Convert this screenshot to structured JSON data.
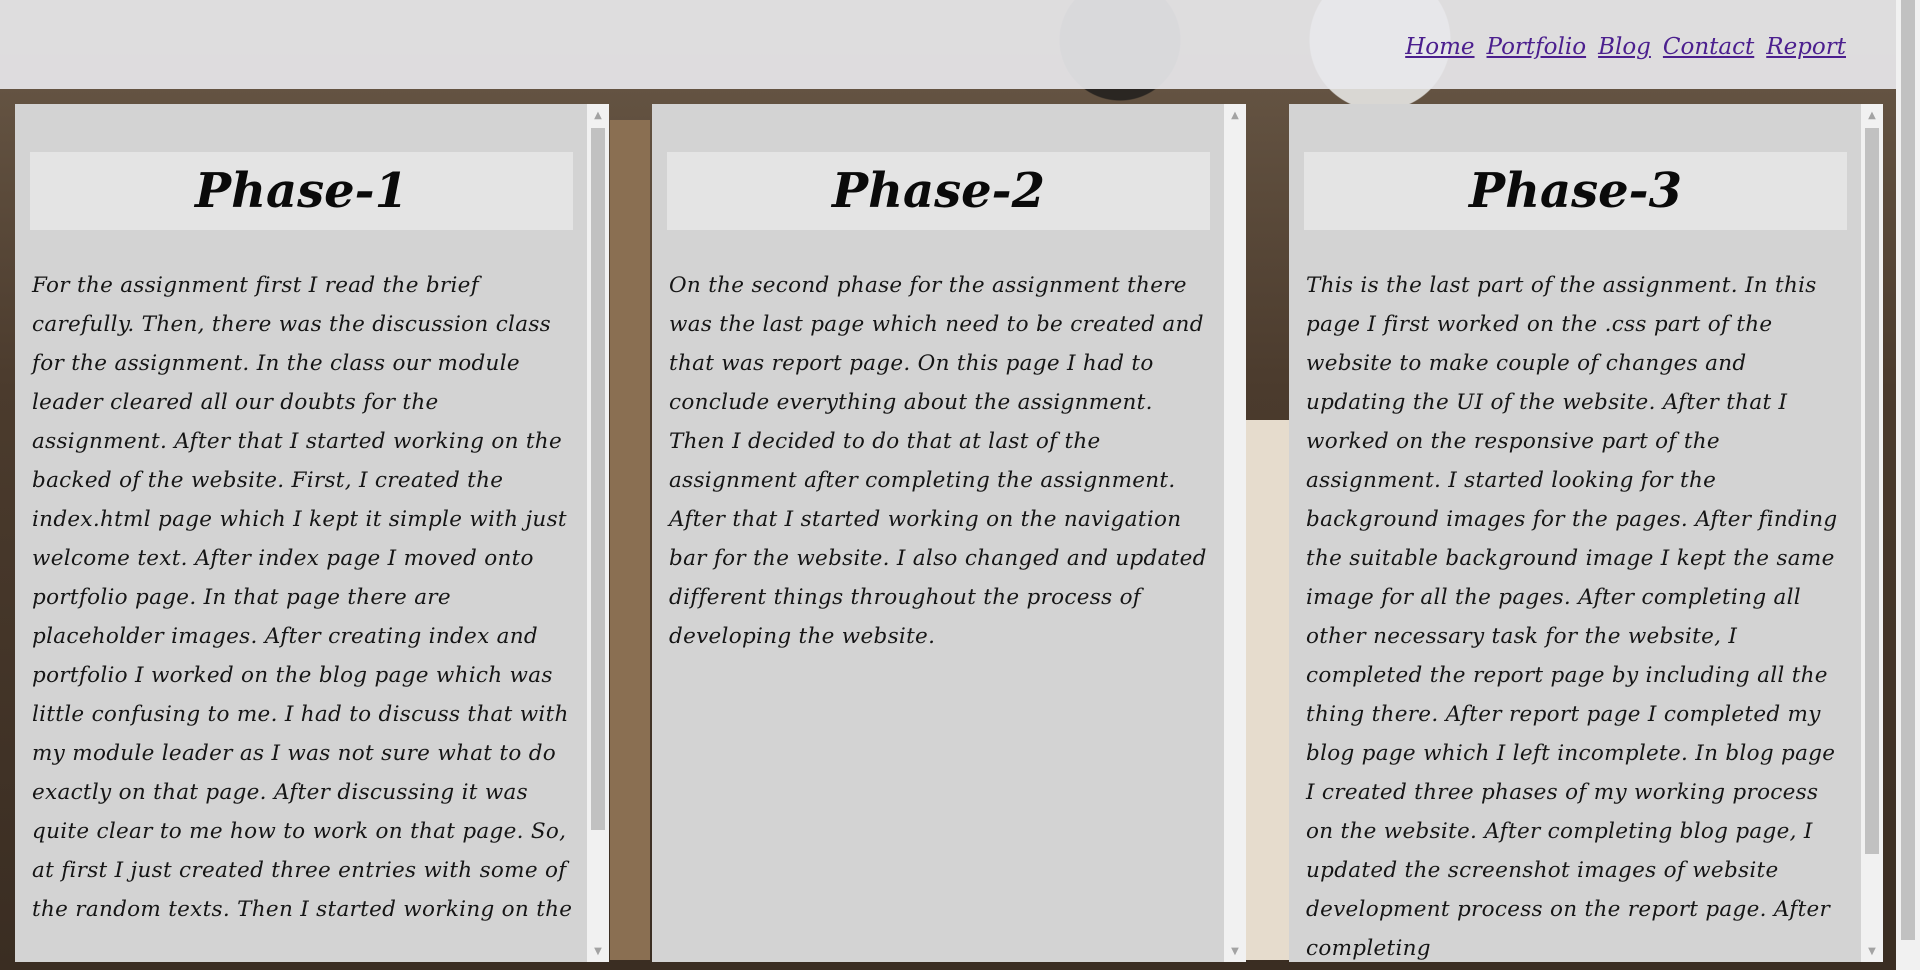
{
  "nav": {
    "items": [
      "Home",
      "Portfolio",
      "Blog",
      "Contact",
      "Report"
    ]
  },
  "phases": [
    {
      "title": "Phase-1",
      "text": "For the assignment first I read the brief carefully. Then, there was the discussion class for the assignment. In the class our module leader cleared all our doubts for the assignment. After that I started working on the backed of the website. First, I created the index.html page which I kept it simple with just welcome text. After index page I moved onto portfolio page. In that page there are placeholder images. After creating index and portfolio I worked on the blog page which was little confusing to me. I had to discuss that with my module leader as I was not sure what to do exactly on that page. After discussing it was quite clear to me how to work on that page. So, at first I just created three entries with some of the random texts. Then I started working on the"
    },
    {
      "title": "Phase-2",
      "text": "On the second phase for the assignment there was the last page which need to be created and that was report page. On this page I had to conclude everything about the assignment. Then I decided to do that at last of the assignment after completing the assignment. After that I started working on the navigation bar for the website. I also changed and updated different things throughout the process of developing the website."
    },
    {
      "title": "Phase-3",
      "text": "This is the last part of the assignment. In this page I first worked on the .css part of the website to make couple of changes and updating the UI of the website. After that I worked on the responsive part of the assignment. I started looking for the background images for the pages. After finding the suitable background image I kept the same image for all the pages. After completing all other necessary task for the website, I completed the report page by including all the thing there. After report page I completed my blog page which I left incomplete. In blog page I created three phases of my working process on the website. After completing blog page, I updated the screenshot images of website development process on the report page. After completing"
    }
  ],
  "scroll": {
    "up_icon": "arrow-up-icon",
    "down_icon": "arrow-down-icon"
  }
}
